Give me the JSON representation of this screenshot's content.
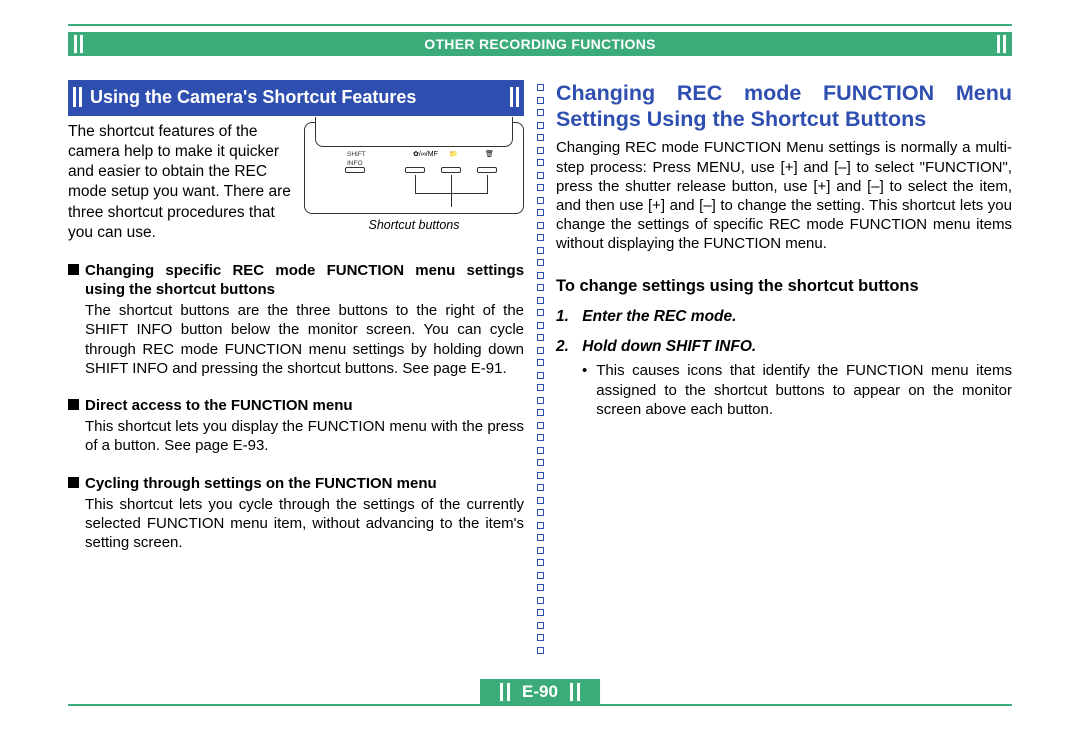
{
  "header": {
    "title": "OTHER RECORDING FUNCTIONS"
  },
  "left": {
    "heading": "Using the Camera's Shortcut Features",
    "lead": "The shortcut features of the camera help to make it quicker and easier to obtain the REC mode setup you want. There are three shortcut procedures that you can use.",
    "diagram": {
      "label_shift": "SHIFT",
      "label_info": "INFO",
      "caption": "Shortcut buttons"
    },
    "sections": [
      {
        "head": "Changing specific REC mode FUNCTION menu settings using the shortcut buttons",
        "body": "The shortcut buttons are the three buttons to the right of the SHIFT INFO button below the monitor screen. You can cycle through REC mode FUNCTION menu settings by holding down SHIFT INFO and pressing the shortcut buttons. See page E-91."
      },
      {
        "head": "Direct access to the FUNCTION menu",
        "body": "This shortcut lets you display the FUNCTION menu with the press of a button. See page E-93."
      },
      {
        "head": "Cycling through settings on the FUNCTION menu",
        "body": "This shortcut lets you cycle through the settings of the currently selected FUNCTION menu item, without advancing to the item's setting screen."
      }
    ]
  },
  "right": {
    "heading": "Changing REC mode FUNCTION Menu Settings Using the Shortcut Buttons",
    "para": "Changing REC mode FUNCTION Menu settings is normally a multi-step process: Press MENU, use [+] and [–] to select \"FUNCTION\", press the shutter release button, use [+] and [–] to select the item, and then use [+] and [–] to change the setting. This shortcut lets you change the settings of specific REC mode FUNCTION menu items without displaying the FUNCTION menu.",
    "sub": "To change settings using the shortcut buttons",
    "steps": [
      {
        "num": "1.",
        "text": "Enter the REC mode."
      },
      {
        "num": "2.",
        "text": "Hold down SHIFT INFO."
      }
    ],
    "bullet": "This causes icons that identify the FUNCTION menu items assigned to the shortcut buttons to appear on the monitor screen above each button."
  },
  "page_number": "E-90"
}
